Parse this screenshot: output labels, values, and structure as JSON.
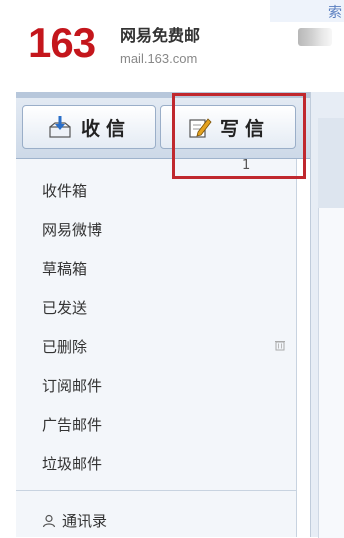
{
  "header": {
    "logo_number": "163",
    "brand_name": "网易免费邮",
    "brand_url": "mail.163.com",
    "top_right_tab_text": "索"
  },
  "toolbar": {
    "receive_label": "收信",
    "compose_label": "写信",
    "marker_text": "1"
  },
  "folders": [
    {
      "label": "收件箱"
    },
    {
      "label": "网易微博"
    },
    {
      "label": "草稿箱"
    },
    {
      "label": "已发送"
    },
    {
      "label": "已删除"
    },
    {
      "label": "订阅邮件"
    },
    {
      "label": "广告邮件"
    },
    {
      "label": "垃圾邮件"
    }
  ],
  "contacts": {
    "label": "通讯录"
  },
  "colors": {
    "brand_red": "#c4161c",
    "highlight": "#c0282e"
  }
}
